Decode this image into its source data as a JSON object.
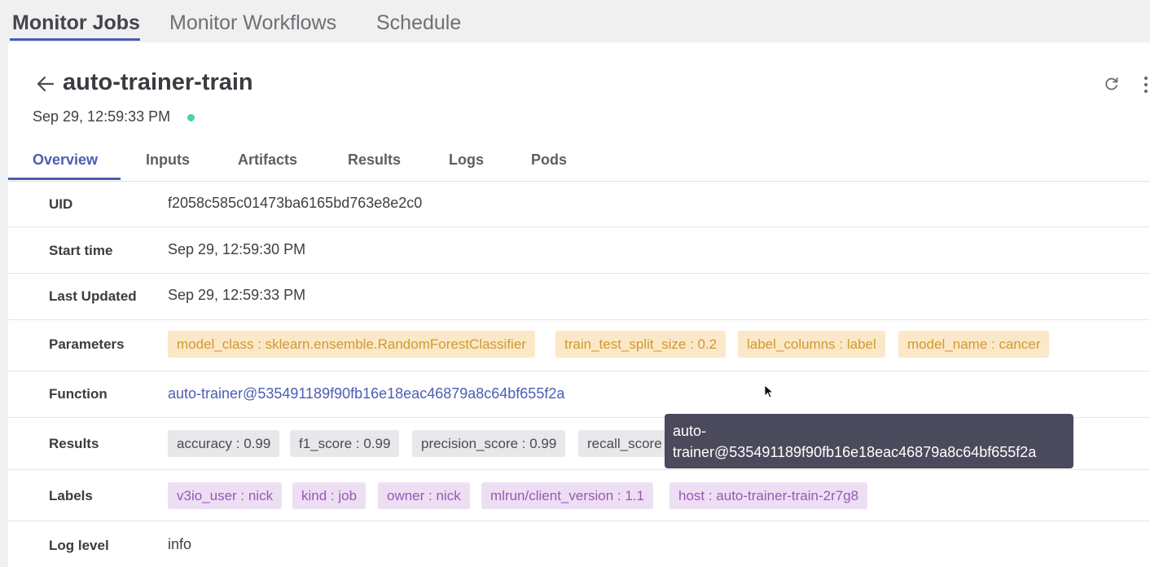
{
  "top_tabs": [
    {
      "label": "Monitor Jobs",
      "active": true
    },
    {
      "label": "Monitor Workflows",
      "active": false
    },
    {
      "label": "Schedule",
      "active": false
    }
  ],
  "job": {
    "title": "auto-trainer-train",
    "date": "Sep 29, 12:59:33 PM",
    "status_color": "#4fd1a5"
  },
  "detail_tabs": [
    {
      "label": "Overview",
      "active": true
    },
    {
      "label": "Inputs",
      "active": false
    },
    {
      "label": "Artifacts",
      "active": false
    },
    {
      "label": "Results",
      "active": false
    },
    {
      "label": "Logs",
      "active": false
    },
    {
      "label": "Pods",
      "active": false
    }
  ],
  "overview": {
    "uid": {
      "label": "UID",
      "value": "f2058c585c01473ba6165bd763e8e2c0"
    },
    "start_time": {
      "label": "Start time",
      "value": "Sep 29, 12:59:30 PM"
    },
    "last_updated": {
      "label": "Last Updated",
      "value": "Sep 29, 12:59:33 PM"
    },
    "parameters": {
      "label": "Parameters",
      "chips": [
        "model_class : sklearn.ensemble.RandomForestClassifier",
        "train_test_split_size : 0.2",
        "label_columns : label",
        "model_name : cancer"
      ]
    },
    "function": {
      "label": "Function",
      "value": "auto-trainer@535491189f90fb16e18eac46879a8c64bf655f2a"
    },
    "results": {
      "label": "Results",
      "chips": [
        "accuracy : 0.99",
        "f1_score : 0.99",
        "precision_score : 0.99",
        "recall_score"
      ]
    },
    "labels": {
      "label": "Labels",
      "chips": [
        "v3io_user : nick",
        "kind : job",
        "owner : nick",
        "mlrun/client_version : 1.1",
        "host : auto-trainer-train-2r7g8"
      ]
    },
    "log_level": {
      "label": "Log level",
      "value": "info"
    }
  },
  "tooltip": {
    "line1": "auto-",
    "line2": "trainer@535491189f90fb16e18eac46879a8c64bf655f2a"
  },
  "icons": [
    "back-arrow-icon",
    "refresh-icon",
    "kebab-menu-icon",
    "cursor-icon"
  ],
  "colors": {
    "accent": "#4d5db3",
    "param_chip": "#fbe8c8",
    "label_chip": "#eddff3",
    "result_chip": "#e8e8eb"
  }
}
